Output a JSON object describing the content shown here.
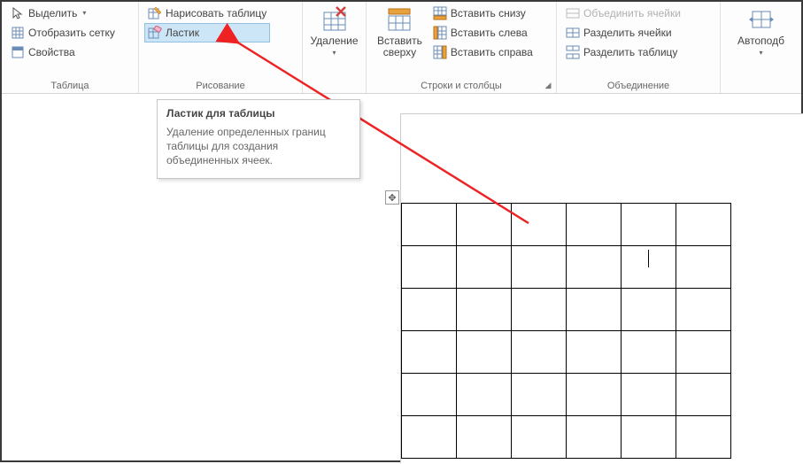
{
  "groups": {
    "table": {
      "label": "Таблица",
      "select": "Выделить",
      "show_grid": "Отобразить сетку",
      "properties": "Свойства"
    },
    "drawing": {
      "label": "Рисование",
      "draw_table": "Нарисовать таблицу",
      "eraser": "Ластик"
    },
    "delete": {
      "label": "Удаление"
    },
    "rows_cols": {
      "label": "Строки и столбцы",
      "insert_above": "Вставить\nсверху",
      "insert_below": "Вставить снизу",
      "insert_left": "Вставить слева",
      "insert_right": "Вставить справа"
    },
    "merge": {
      "label": "Объединение",
      "merge_cells": "Объединить ячейки",
      "split_cells": "Разделить ячейки",
      "split_table": "Разделить таблицу"
    },
    "autofit": {
      "label": "Автоподб"
    }
  },
  "tooltip": {
    "title": "Ластик для таблицы",
    "body": "Удаление определенных границ таблицы для создания объединенных ячеек."
  }
}
